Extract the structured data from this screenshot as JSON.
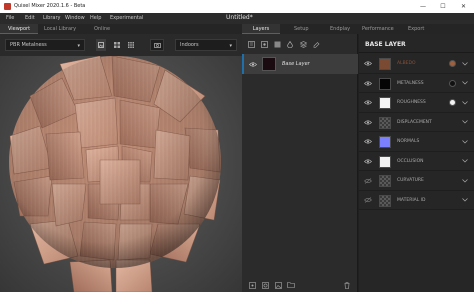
{
  "window": {
    "title": "Quixel Mixer 2020.1.6 - Beta",
    "doc_title": "Untitled*",
    "minimize_glyph": "—",
    "maximize_glyph": "☐",
    "close_glyph": "✕"
  },
  "menu": [
    "File",
    "Edit",
    "Library",
    "Window",
    "Help",
    "Experimental"
  ],
  "left_tabs": [
    "Viewport",
    "Local Library",
    "Online"
  ],
  "viewport_toolbar": {
    "shader_mode": "PBR Metalness",
    "environment": "Indoors"
  },
  "right_tabs": [
    "Layers",
    "Setup",
    "Endplay",
    "Performance",
    "Export"
  ],
  "layers": [
    {
      "name": "Base Layer"
    }
  ],
  "properties": {
    "title": "BASE LAYER",
    "channels": [
      {
        "name": "ALBEDO",
        "color": "#8a5238",
        "swatch": "#7a4a32",
        "show_dot": true,
        "dot": "#a0603e"
      },
      {
        "name": "METALNESS",
        "color": "#aaaaaa",
        "swatch": "#050505",
        "show_dot": true,
        "dot": "#111111"
      },
      {
        "name": "ROUGHNESS",
        "color": "#aaaaaa",
        "swatch": "#f4f4f4",
        "show_dot": true,
        "dot": "#f4f4f4"
      },
      {
        "name": "DISPLACEMENT",
        "color": "#aaaaaa",
        "swatch": "checker",
        "show_dot": false,
        "dot": ""
      },
      {
        "name": "NORMALS",
        "color": "#aaaaaa",
        "swatch": "#7b80ff",
        "show_dot": false,
        "dot": ""
      },
      {
        "name": "OCCLUSION",
        "color": "#aaaaaa",
        "swatch": "#f2f2f2",
        "show_dot": false,
        "dot": ""
      },
      {
        "name": "CURVATURE",
        "color": "#aaaaaa",
        "swatch": "checker",
        "show_dot": false,
        "dot": ""
      },
      {
        "name": "MATERIAL ID",
        "color": "#aaaaaa",
        "swatch": "checker",
        "show_dot": false,
        "dot": ""
      }
    ]
  },
  "colors": {
    "accent": "#1f6fa8",
    "app_icon": "#c0392b"
  },
  "icons": {
    "eye": "eye-icon",
    "chevron": "chevron-down-icon",
    "trash": "trash-icon",
    "folder": "folder-icon"
  }
}
